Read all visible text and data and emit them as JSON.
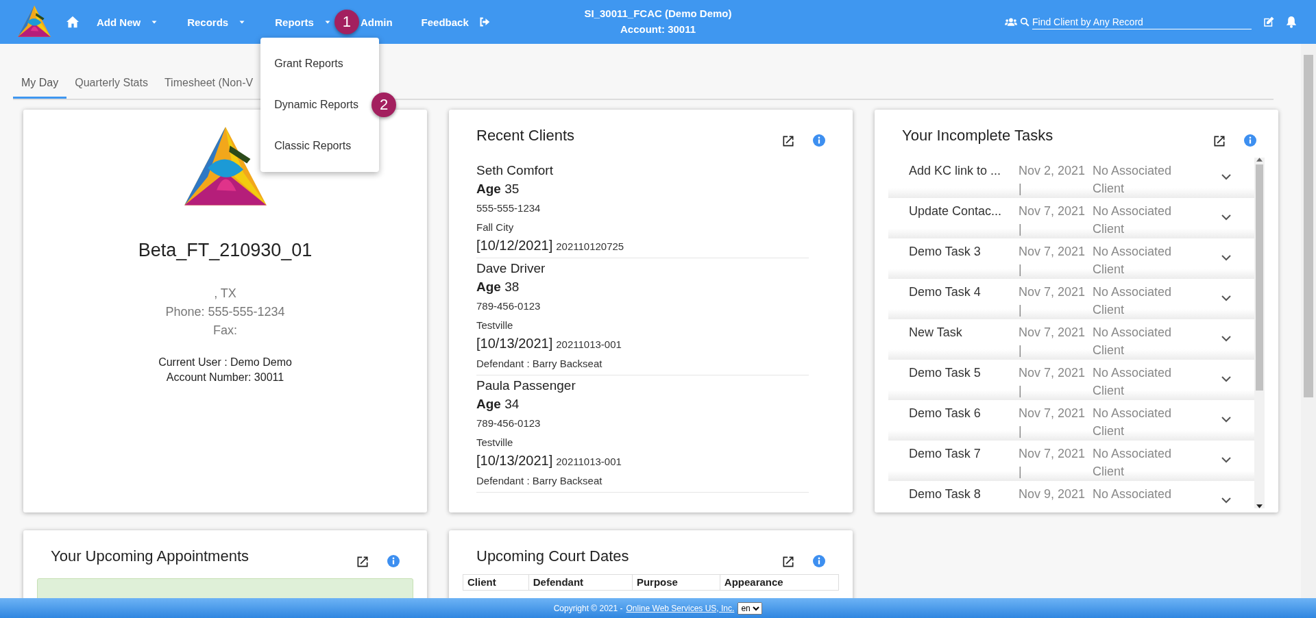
{
  "header": {
    "nav": [
      {
        "label": "Add New",
        "has_menu": true
      },
      {
        "label": "Records",
        "has_menu": true
      },
      {
        "label": "Reports",
        "has_menu": true,
        "callout": "1",
        "open_menu": {
          "items": [
            {
              "label": "Grant Reports"
            },
            {
              "label": "Dynamic Reports",
              "callout": "2"
            },
            {
              "label": "Classic Reports"
            }
          ]
        }
      },
      {
        "label": "Admin",
        "has_menu": false
      },
      {
        "label": "Feedback",
        "has_menu": false
      }
    ],
    "account_title": "SI_30011_FCAC (Demo Demo)",
    "account_line": "Account: 30011",
    "search": {
      "placeholder": "Find Client by Any Record"
    }
  },
  "tabs": [
    {
      "label": "My Day",
      "selected": true
    },
    {
      "label": "Quarterly Stats",
      "selected": false
    },
    {
      "label": "Timesheet (Non-V",
      "selected": false
    }
  ],
  "organization_card": {
    "name": "Beta_FT_210930_01",
    "location": ", TX",
    "phone": "Phone: 555-555-1234",
    "fax": "Fax:",
    "current_user": "Current User : Demo Demo",
    "account_number": "Account Number: 30011"
  },
  "recent_clients": {
    "title": "Recent Clients",
    "clients": [
      {
        "name": "Seth Comfort",
        "age_label": "Age",
        "age": "35",
        "phone": "555-555-1234",
        "city": "Fall City",
        "date": "[10/12/2021]",
        "case": "202110120725"
      },
      {
        "name": "Dave Driver",
        "age_label": "Age",
        "age": "38",
        "phone": "789-456-0123",
        "city": "Testville",
        "date": "[10/13/2021]",
        "case": "20211013-001",
        "defendant": "Defendant : Barry Backseat"
      },
      {
        "name": "Paula Passenger",
        "age_label": "Age",
        "age": "34",
        "phone": "789-456-0123",
        "city": "Testville",
        "date": "[10/13/2021]",
        "case": "20211013-001",
        "defendant": "Defendant : Barry Backseat"
      }
    ]
  },
  "tasks": {
    "title": "Your Incomplete Tasks",
    "items": [
      {
        "name": "Add KC link to ...",
        "date": "Nov 2, 2021\n|",
        "client": "No Associated Client"
      },
      {
        "name": "Update Contac...",
        "date": "Nov 7, 2021\n|",
        "client": "No Associated Client"
      },
      {
        "name": "Demo Task 3",
        "date": "Nov 7, 2021\n|",
        "client": "No Associated Client"
      },
      {
        "name": "Demo Task 4",
        "date": "Nov 7, 2021\n|",
        "client": "No Associated Client"
      },
      {
        "name": "New Task",
        "date": "Nov 7, 2021\n|",
        "client": "No Associated Client"
      },
      {
        "name": "Demo Task 5",
        "date": "Nov 7, 2021\n|",
        "client": "No Associated Client"
      },
      {
        "name": "Demo Task 6",
        "date": "Nov 7, 2021\n|",
        "client": "No Associated Client"
      },
      {
        "name": "Demo Task 7",
        "date": "Nov 7, 2021\n|",
        "client": "No Associated Client"
      },
      {
        "name": "Demo Task 8",
        "date": "Nov 9, 2021",
        "client": "No Associated"
      }
    ]
  },
  "appointments": {
    "title": "Your Upcoming Appointments"
  },
  "court_dates": {
    "title": "Upcoming Court Dates",
    "columns": [
      "Client",
      "Defendant",
      "Purpose",
      "Appearance"
    ]
  },
  "footer": {
    "copyright": "Copyright © 2021 -",
    "link": "Online Web Services US, Inc.",
    "language": "en"
  }
}
